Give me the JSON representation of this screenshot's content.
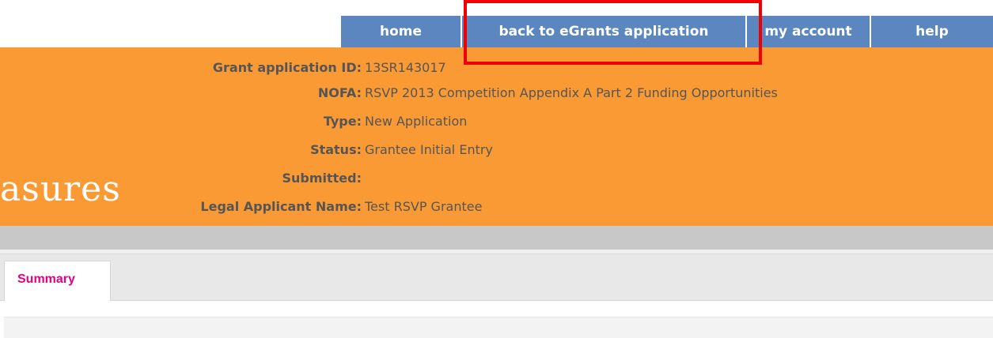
{
  "nav": {
    "home": "home",
    "back": "back to eGrants application",
    "account": "my account",
    "help": "help"
  },
  "logo_text": "asures",
  "info": {
    "grant_id_label": "Grant application ID:",
    "grant_id_value": "13SR143017",
    "nofa_label": "NOFA:",
    "nofa_value": "RSVP 2013 Competition Appendix A Part 2 Funding Opportunities",
    "type_label": "Type:",
    "type_value": "New Application",
    "status_label": "Status:",
    "status_value": "Grantee Initial Entry",
    "submitted_label": "Submitted:",
    "submitted_value": "",
    "legal_label": "Legal Applicant Name:",
    "legal_value": "Test RSVP Grantee"
  },
  "tabs": {
    "summary": "Summary"
  },
  "colors": {
    "header_orange": "#fa9a35",
    "nav_blue": "#5b86c0",
    "highlight_red": "#f00000",
    "tab_pink": "#e6007e"
  }
}
